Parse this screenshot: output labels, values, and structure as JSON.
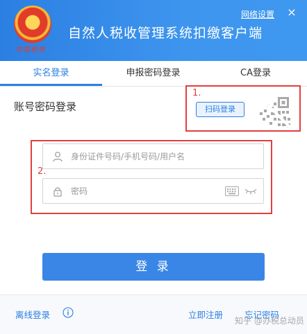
{
  "header": {
    "logo_text": "中国税务",
    "title": "自然人税收管理系统扣缴客户端",
    "network_settings": "网络设置",
    "close_glyph": "×"
  },
  "tabs": [
    {
      "label": "实名登录",
      "active": true
    },
    {
      "label": "申报密码登录",
      "active": false
    },
    {
      "label": "CA登录",
      "active": false
    }
  ],
  "login": {
    "section_title": "账号密码登录",
    "scan_button": "扫码登录",
    "username_placeholder": "身份证件号码/手机号码/用户名",
    "password_placeholder": "密码",
    "submit": "登 录"
  },
  "annotations": [
    {
      "label": "1."
    },
    {
      "label": "2."
    }
  ],
  "footer": {
    "offline_login": "离线登录",
    "register": "立即注册",
    "forgot_password": "忘记密码",
    "watermark": "知乎 @办税总动员"
  },
  "colors": {
    "brand_blue": "#2b7fe2",
    "annotation_red": "#e0403d"
  },
  "icons": [
    "user-icon",
    "lock-icon",
    "keyboard-icon",
    "eye-closed-icon",
    "qr-code-icon",
    "info-icon",
    "close-icon",
    "emblem-icon"
  ]
}
